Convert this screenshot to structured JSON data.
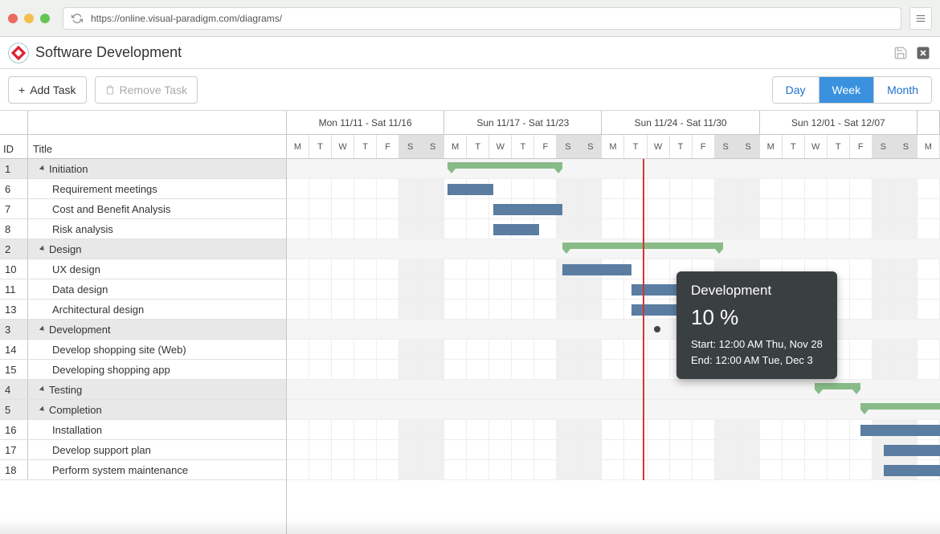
{
  "chrome": {
    "url": "https://online.visual-paradigm.com/diagrams/"
  },
  "doc": {
    "title": "Software Development"
  },
  "toolbar": {
    "add_task": "Add Task",
    "remove_task": "Remove Task"
  },
  "view": {
    "day": "Day",
    "week": "Week",
    "month": "Month",
    "active": "week"
  },
  "columns": {
    "id": "ID",
    "title": "Title"
  },
  "weeks": [
    {
      "label": "Mon 11/11 - Sat 11/16",
      "days": 7
    },
    {
      "label": "Sun 11/17 - Sat 11/23",
      "days": 7
    },
    {
      "label": "Sun 11/24 - Sat 11/30",
      "days": 7
    },
    {
      "label": "Sun 12/01 - Sat 12/07",
      "days": 7
    },
    {
      "label": "",
      "days": 1
    }
  ],
  "day_letters": [
    "M",
    "T",
    "W",
    "T",
    "F",
    "S",
    "S",
    "M",
    "T",
    "W",
    "T",
    "F",
    "S",
    "S",
    "M",
    "T",
    "W",
    "T",
    "F",
    "S",
    "S",
    "M",
    "T",
    "W",
    "T",
    "F",
    "S",
    "S",
    "M"
  ],
  "weekend_cols": [
    5,
    6,
    12,
    13,
    19,
    20,
    26,
    27
  ],
  "today_col": 15.5,
  "tasks": [
    {
      "id": "1",
      "title": "Initiation",
      "type": "group",
      "indent": 1,
      "bar": {
        "start": 7,
        "span": 5
      }
    },
    {
      "id": "6",
      "title": "Requirement meetings",
      "type": "task",
      "indent": 2,
      "bar": {
        "start": 7,
        "span": 2
      }
    },
    {
      "id": "7",
      "title": "Cost and Benefit Analysis",
      "type": "task",
      "indent": 2,
      "bar": {
        "start": 9,
        "span": 3
      }
    },
    {
      "id": "8",
      "title": "Risk analysis",
      "type": "task",
      "indent": 2,
      "bar": {
        "start": 9,
        "span": 2
      }
    },
    {
      "id": "2",
      "title": "Design",
      "type": "group",
      "indent": 1,
      "bar": {
        "start": 12,
        "span": 7
      }
    },
    {
      "id": "10",
      "title": "UX design",
      "type": "task",
      "indent": 2,
      "bar": {
        "start": 12,
        "span": 3
      }
    },
    {
      "id": "11",
      "title": "Data design",
      "type": "task",
      "indent": 2,
      "bar": {
        "start": 15,
        "span": 2
      }
    },
    {
      "id": "13",
      "title": "Architectural design",
      "type": "task",
      "indent": 2,
      "bar": {
        "start": 15,
        "span": 3
      }
    },
    {
      "id": "3",
      "title": "Development",
      "type": "group",
      "indent": 1,
      "bar": {
        "start": 17,
        "span": 5.8
      },
      "ms": [
        16,
        22.3
      ]
    },
    {
      "id": "14",
      "title": "Develop shopping site (Web)",
      "type": "task",
      "indent": 2,
      "bar": {
        "start": 17,
        "span": 5
      }
    },
    {
      "id": "15",
      "title": "Developing shopping app",
      "type": "task",
      "indent": 2,
      "bar": {
        "start": 19,
        "span": 3
      }
    },
    {
      "id": "4",
      "title": "Testing",
      "type": "group",
      "indent": 1,
      "bar": {
        "start": 23,
        "span": 2
      }
    },
    {
      "id": "5",
      "title": "Completion",
      "type": "group",
      "indent": 1,
      "bar": {
        "start": 25,
        "span": 4
      }
    },
    {
      "id": "16",
      "title": "Installation",
      "type": "task",
      "indent": 2,
      "bar": {
        "start": 25,
        "span": 4
      }
    },
    {
      "id": "17",
      "title": "Develop support plan",
      "type": "task",
      "indent": 2,
      "bar": {
        "start": 26,
        "span": 3
      }
    },
    {
      "id": "18",
      "title": "Perform system maintenance",
      "type": "task",
      "indent": 2,
      "bar": {
        "start": 26,
        "span": 3
      }
    }
  ],
  "tooltip": {
    "title": "Development",
    "percent": "10 %",
    "start": "Start: 12:00 AM Thu, Nov 28",
    "end": "End: 12:00 AM Tue, Dec 3"
  }
}
